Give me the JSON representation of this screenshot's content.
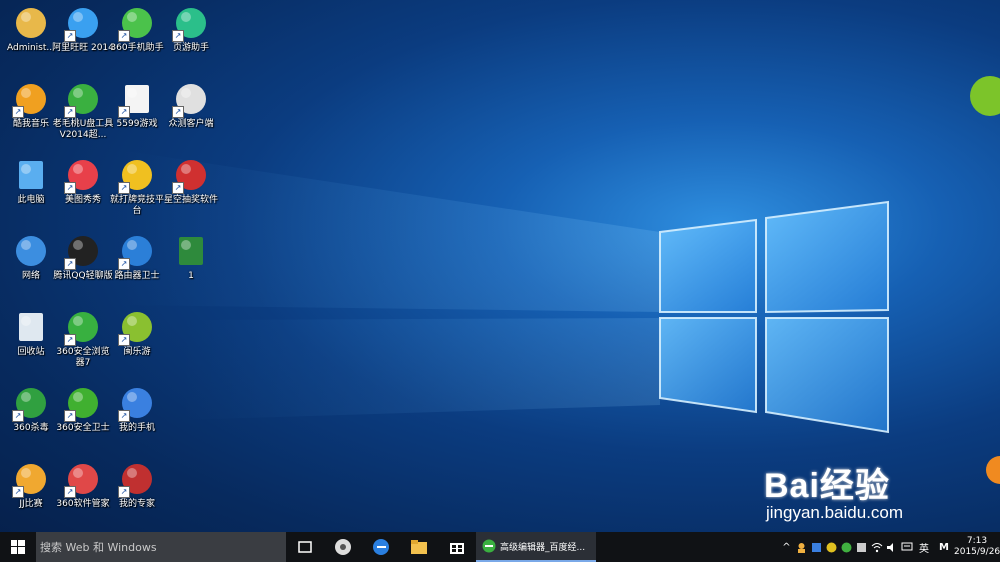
{
  "desktop_icons": [
    {
      "label": "Administ...",
      "icon": "user-folder-icon",
      "color": "#e8b84a"
    },
    {
      "label": "阿里旺旺\n2014",
      "icon": "aliwangwang-icon",
      "color": "#3aa0f0"
    },
    {
      "label": "360手机助手",
      "icon": "360-phone-assistant-icon",
      "color": "#4bc24b"
    },
    {
      "label": "页游助手",
      "icon": "webgame-assistant-icon",
      "color": "#2bbf8a"
    },
    {
      "label": "酷我音乐",
      "icon": "kuwo-music-icon",
      "color": "#f0a020"
    },
    {
      "label": "老毛桃U盘工具V2014超...",
      "icon": "usb-tool-icon",
      "color": "#3ab040"
    },
    {
      "label": "5599游戏",
      "icon": "blank-file-icon",
      "color": "#f4f4f4"
    },
    {
      "label": "众测客户端",
      "icon": "zhongce-client-icon",
      "color": "#e0e0e0"
    },
    {
      "label": "此电脑",
      "icon": "this-pc-icon",
      "color": "#5aaef0"
    },
    {
      "label": "美图秀秀",
      "icon": "meitu-icon",
      "color": "#e8404a"
    },
    {
      "label": "就打牌竞技平台",
      "icon": "card-game-icon",
      "color": "#f0c020"
    },
    {
      "label": "星空抽奖软件",
      "icon": "star-lottery-icon",
      "color": "#d03030"
    },
    {
      "label": "网络",
      "icon": "network-icon",
      "color": "#3c8ee0"
    },
    {
      "label": "腾讯QQ轻聊版",
      "icon": "qq-icon",
      "color": "#222222"
    },
    {
      "label": "路由器卫士",
      "icon": "router-guard-icon",
      "color": "#2b7fd8"
    },
    {
      "label": "1",
      "icon": "excel-file-icon",
      "color": "#2e8a3c"
    },
    {
      "label": "回收站",
      "icon": "recycle-bin-icon",
      "color": "#dfe8f0"
    },
    {
      "label": "360安全浏览器7",
      "icon": "360-browser-icon",
      "color": "#38b040"
    },
    {
      "label": "闽乐游",
      "icon": "minleyou-icon",
      "color": "#8ac030"
    },
    {
      "label": "360杀毒",
      "icon": "360-antivirus-icon",
      "color": "#30a040"
    },
    {
      "label": "360安全卫士",
      "icon": "360-security-icon",
      "color": "#40b030"
    },
    {
      "label": "我的手机",
      "icon": "my-phone-icon",
      "color": "#3a80e0"
    },
    {
      "label": "JJ比赛",
      "icon": "jj-match-icon",
      "color": "#f0a830"
    },
    {
      "label": "360软件管家",
      "icon": "360-software-manager-icon",
      "color": "#e04848"
    },
    {
      "label": "我的专家",
      "icon": "my-expert-icon",
      "color": "#c03030"
    }
  ],
  "taskbar": {
    "search_placeholder": "搜索 Web 和 Windows",
    "active_app_label": "高级编辑器_百度经...",
    "ime_label": "英",
    "time": "7:13",
    "date": "2015/9/26"
  },
  "watermark": {
    "top": "Bai经验",
    "bottom": "jingyan.baidu.com"
  },
  "colors": {
    "taskbar_bg": "#101215",
    "search_bg": "#3a3d42",
    "accent": "#7aa9e8"
  }
}
